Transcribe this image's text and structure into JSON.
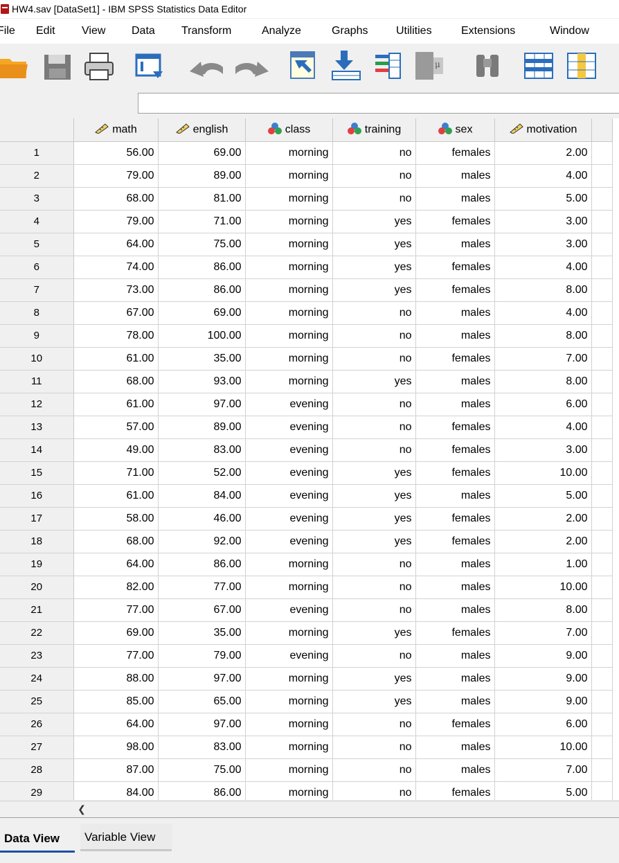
{
  "window": {
    "title": "HW4.sav [DataSet1] - IBM SPSS Statistics Data Editor"
  },
  "menu": [
    "File",
    "Edit",
    "View",
    "Data",
    "Transform",
    "Analyze",
    "Graphs",
    "Utilities",
    "Extensions",
    "Window"
  ],
  "toolbar": {
    "icons": [
      "open-folder-icon",
      "save-icon",
      "print-icon",
      "recall-dialog-icon",
      "undo-icon",
      "redo-icon",
      "goto-case-icon",
      "goto-variable-icon",
      "variables-icon",
      "run-descriptive-icon",
      "find-icon",
      "insert-cases-icon",
      "insert-variable-icon"
    ]
  },
  "cell_editor": {
    "value": ""
  },
  "grid": {
    "columns": [
      {
        "name": "math",
        "measure": "scale"
      },
      {
        "name": "english",
        "measure": "scale"
      },
      {
        "name": "class",
        "measure": "nominal"
      },
      {
        "name": "training",
        "measure": "nominal"
      },
      {
        "name": "sex",
        "measure": "nominal"
      },
      {
        "name": "motivation",
        "measure": "scale"
      }
    ],
    "rows": [
      [
        "1",
        "56.00",
        "69.00",
        "morning",
        "no",
        "females",
        "2.00"
      ],
      [
        "2",
        "79.00",
        "89.00",
        "morning",
        "no",
        "males",
        "4.00"
      ],
      [
        "3",
        "68.00",
        "81.00",
        "morning",
        "no",
        "males",
        "5.00"
      ],
      [
        "4",
        "79.00",
        "71.00",
        "morning",
        "yes",
        "females",
        "3.00"
      ],
      [
        "5",
        "64.00",
        "75.00",
        "morning",
        "yes",
        "males",
        "3.00"
      ],
      [
        "6",
        "74.00",
        "86.00",
        "morning",
        "yes",
        "females",
        "4.00"
      ],
      [
        "7",
        "73.00",
        "86.00",
        "morning",
        "yes",
        "females",
        "8.00"
      ],
      [
        "8",
        "67.00",
        "69.00",
        "morning",
        "no",
        "males",
        "4.00"
      ],
      [
        "9",
        "78.00",
        "100.00",
        "morning",
        "no",
        "males",
        "8.00"
      ],
      [
        "10",
        "61.00",
        "35.00",
        "morning",
        "no",
        "females",
        "7.00"
      ],
      [
        "11",
        "68.00",
        "93.00",
        "morning",
        "yes",
        "males",
        "8.00"
      ],
      [
        "12",
        "61.00",
        "97.00",
        "evening",
        "no",
        "males",
        "6.00"
      ],
      [
        "13",
        "57.00",
        "89.00",
        "evening",
        "no",
        "females",
        "4.00"
      ],
      [
        "14",
        "49.00",
        "83.00",
        "evening",
        "no",
        "females",
        "3.00"
      ],
      [
        "15",
        "71.00",
        "52.00",
        "evening",
        "yes",
        "females",
        "10.00"
      ],
      [
        "16",
        "61.00",
        "84.00",
        "evening",
        "yes",
        "males",
        "5.00"
      ],
      [
        "17",
        "58.00",
        "46.00",
        "evening",
        "yes",
        "females",
        "2.00"
      ],
      [
        "18",
        "68.00",
        "92.00",
        "evening",
        "yes",
        "females",
        "2.00"
      ],
      [
        "19",
        "64.00",
        "86.00",
        "morning",
        "no",
        "males",
        "1.00"
      ],
      [
        "20",
        "82.00",
        "77.00",
        "morning",
        "no",
        "males",
        "10.00"
      ],
      [
        "21",
        "77.00",
        "67.00",
        "evening",
        "no",
        "males",
        "8.00"
      ],
      [
        "22",
        "69.00",
        "35.00",
        "morning",
        "yes",
        "females",
        "7.00"
      ],
      [
        "23",
        "77.00",
        "79.00",
        "evening",
        "no",
        "males",
        "9.00"
      ],
      [
        "24",
        "88.00",
        "97.00",
        "morning",
        "yes",
        "males",
        "9.00"
      ],
      [
        "25",
        "85.00",
        "65.00",
        "morning",
        "yes",
        "males",
        "9.00"
      ],
      [
        "26",
        "64.00",
        "97.00",
        "morning",
        "no",
        "females",
        "6.00"
      ],
      [
        "27",
        "98.00",
        "83.00",
        "morning",
        "no",
        "males",
        "10.00"
      ],
      [
        "28",
        "87.00",
        "75.00",
        "morning",
        "no",
        "males",
        "7.00"
      ],
      [
        "29",
        "84.00",
        "86.00",
        "morning",
        "no",
        "females",
        "5.00"
      ]
    ]
  },
  "tabs": [
    {
      "label": "Data View",
      "active": true
    },
    {
      "label": "Variable View",
      "active": false
    }
  ],
  "colors": {
    "active_tab_underline": "#1e4fa8",
    "toolbar_blue": "#2a6ebb",
    "title_icon": "#b01818"
  }
}
